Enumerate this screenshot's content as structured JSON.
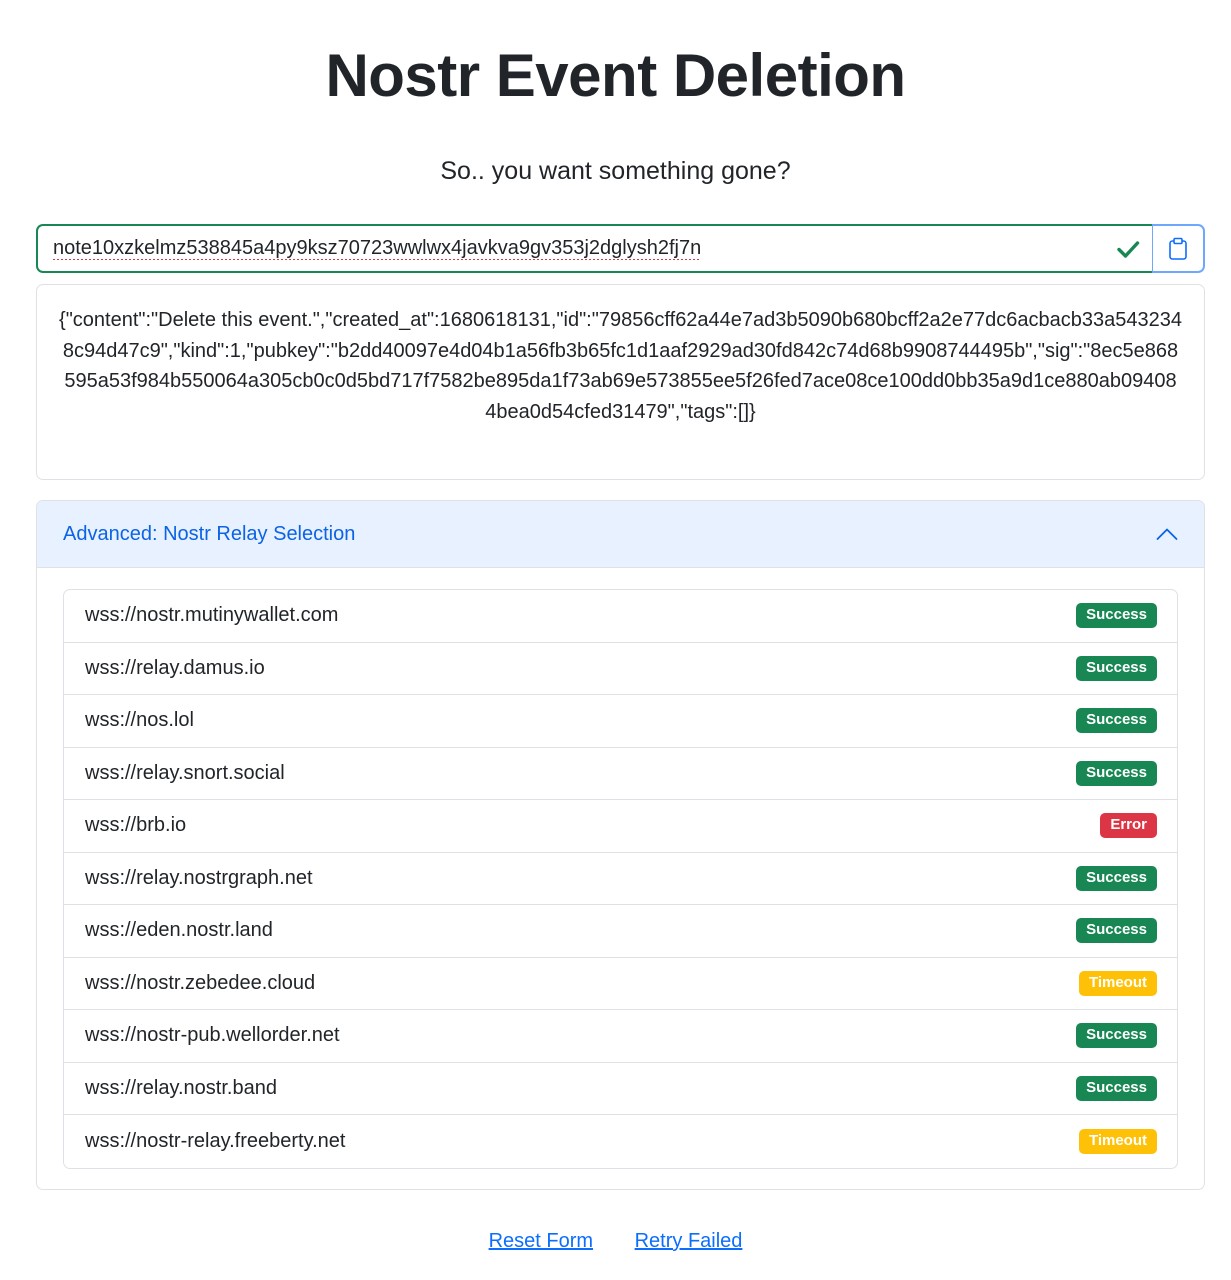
{
  "header": {
    "title": "Nostr Event Deletion",
    "subtitle": "So.. you want something gone?"
  },
  "event_input": {
    "value": "note10xzkelmz538845a4py9ksz70723wwlwx4javkva9gv353j2dglysh2fj7n",
    "valid": true,
    "check_icon": "check-icon",
    "paste_icon": "clipboard-icon"
  },
  "event_json": "{\"content\":\"Delete this event.\",\"created_at\":1680618131,\"id\":\"79856cff62a44e7ad3b5090b680bcff2a2e77dc6acbacb33a5432348c94d47c9\",\"kind\":1,\"pubkey\":\"b2dd40097e4d04b1a56fb3b65fc1d1aaf2929ad30fd842c74d68b9908744495b\",\"sig\":\"8ec5e868595a53f984b550064a305cb0c0d5bd717f7582be895da1f73ab69e573855ee5f26fed7ace08ce100dd0bb35a9d1ce880ab094084bea0d54cfed31479\",\"tags\":[]}",
  "relays": {
    "header_label": "Advanced: Nostr Relay Selection",
    "expanded": true,
    "items": [
      {
        "url": "wss://nostr.mutinywallet.com",
        "status": "Success"
      },
      {
        "url": "wss://relay.damus.io",
        "status": "Success"
      },
      {
        "url": "wss://nos.lol",
        "status": "Success"
      },
      {
        "url": "wss://relay.snort.social",
        "status": "Success"
      },
      {
        "url": "wss://brb.io",
        "status": "Error"
      },
      {
        "url": "wss://relay.nostrgraph.net",
        "status": "Success"
      },
      {
        "url": "wss://eden.nostr.land",
        "status": "Success"
      },
      {
        "url": "wss://nostr.zebedee.cloud",
        "status": "Timeout"
      },
      {
        "url": "wss://nostr-pub.wellorder.net",
        "status": "Success"
      },
      {
        "url": "wss://relay.nostr.band",
        "status": "Success"
      },
      {
        "url": "wss://nostr-relay.freeberty.net",
        "status": "Timeout"
      }
    ]
  },
  "actions": {
    "reset_label": "Reset Form",
    "retry_label": "Retry Failed"
  },
  "colors": {
    "success": "#198754",
    "error": "#dc3545",
    "timeout": "#ffc107",
    "link": "#0d6efd",
    "accordion_bg": "#e7f1ff"
  }
}
